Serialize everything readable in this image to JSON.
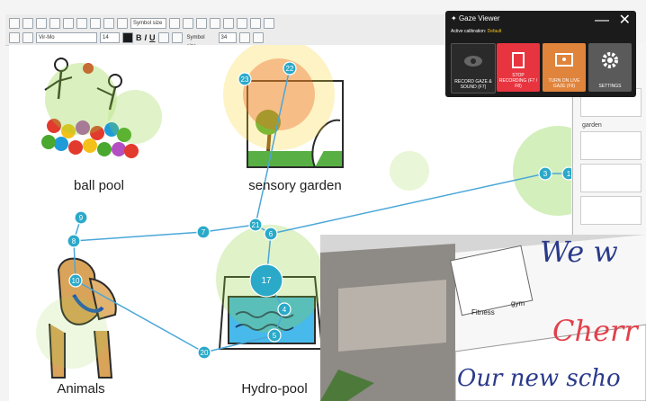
{
  "colors": {
    "accent": "#2aa9c9",
    "record": "#e8343f",
    "turn_on": "#e0843c",
    "settings": "#5a5a5a",
    "calibration_status": "#f2c51a"
  },
  "toolbar": {
    "row1": {
      "font_size": "Symbol size"
    },
    "row2": {
      "font": "Vir-Mo",
      "size": "14",
      "bold": "B",
      "italic": "I",
      "underline": "U",
      "symbol_size_label": "Symbol size",
      "symbol_size_value": "34"
    }
  },
  "symbols": [
    {
      "label": "ball pool"
    },
    {
      "label": "sensory garden"
    },
    {
      "label": "Animals"
    },
    {
      "label": "Hydro-pool"
    }
  ],
  "gaze_markers": [
    {
      "id": "23"
    },
    {
      "id": "22"
    },
    {
      "id": "9"
    },
    {
      "id": "8"
    },
    {
      "id": "7"
    },
    {
      "id": "21"
    },
    {
      "id": "6"
    },
    {
      "id": "10"
    },
    {
      "id": "17"
    },
    {
      "id": "4"
    },
    {
      "id": "5"
    },
    {
      "id": "20"
    },
    {
      "id": "3"
    },
    {
      "id": "1"
    }
  ],
  "gaze_viewer": {
    "title": "Gaze Viewer",
    "active_calibration_label": "Active calibration:",
    "active_calibration_value": "Default",
    "minimize_glyph": "—",
    "close_glyph": "✕",
    "buttons": [
      {
        "label": "RECORD GAZE & SOUND (F7)",
        "icon": "eye-icon"
      },
      {
        "label": "STOP RECORDING (F7 / F8)",
        "icon": "stop-icon"
      },
      {
        "label": "TURN ON LIVE GAZE (F9)",
        "icon": "live-gaze-icon"
      },
      {
        "label": "SETTINGS",
        "icon": "gear-icon"
      }
    ]
  },
  "right_panel": {
    "garden_label": "garden"
  },
  "photo": {
    "board_text": [
      "We w",
      "Cherr",
      "Our new scho"
    ],
    "card_labels": [
      "Fitness",
      "gym"
    ]
  }
}
